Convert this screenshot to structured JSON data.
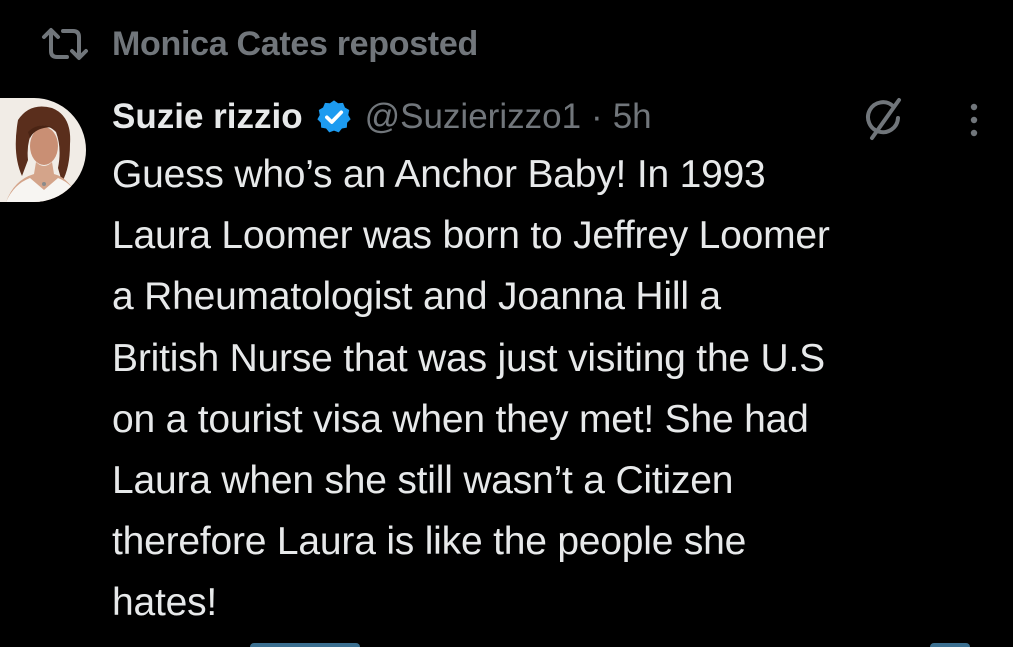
{
  "repost": {
    "icon": "repost-icon",
    "text": "Monica Cates reposted"
  },
  "tweet": {
    "avatar_icon": "user-avatar",
    "display_name": "Suzie rizzio",
    "verified_icon": "verified-badge-icon",
    "handle": "@Suzierizzo1",
    "separator": "·",
    "time": "5h",
    "grok_icon": "grok-icon",
    "more_icon": "more-options-icon",
    "lines": [
      "Guess who’s an Anchor Baby! In 1993",
      "Laura Loomer was born to Jeffrey Loomer",
      "a Rheumatologist and Joanna Hill a",
      "British Nurse that was just visiting the U.S",
      "on a tourist visa when they met! She had",
      "Laura when she still wasn’t a Citizen",
      "therefore Laura is like the people she",
      "hates!"
    ]
  },
  "colors": {
    "background": "#000000",
    "primary_text": "#e7e9ea",
    "secondary_text": "#71767b",
    "verified_blue": "#1d9bf0"
  }
}
